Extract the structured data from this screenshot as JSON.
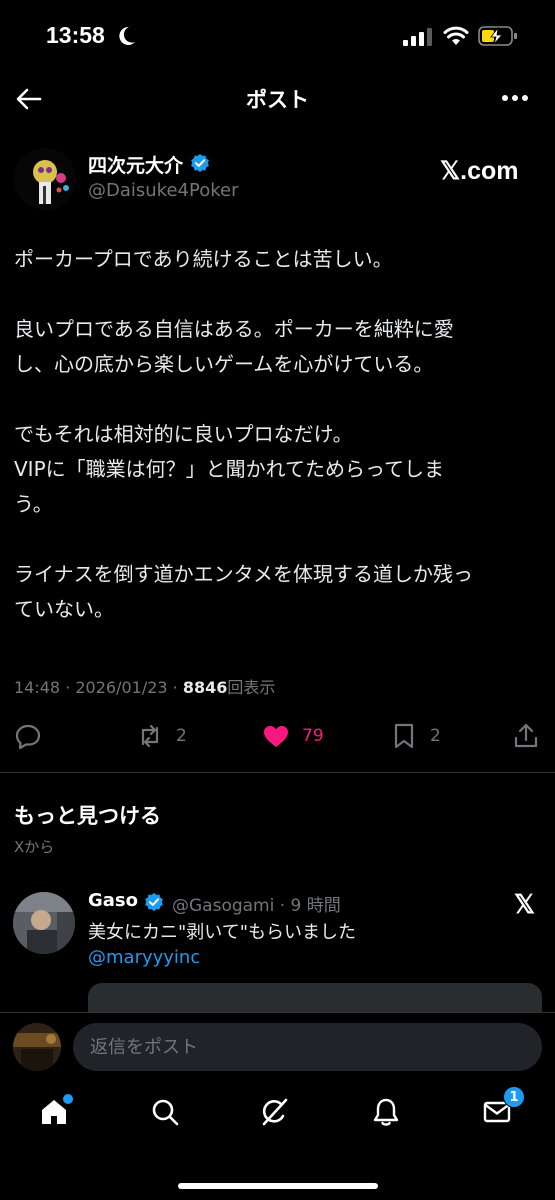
{
  "status_bar": {
    "time": "13:58",
    "icons": [
      "moon-icon",
      "signal-icon",
      "wifi-icon",
      "battery-charging-icon"
    ]
  },
  "header": {
    "title": "ポスト",
    "back_icon": "arrow-left-icon",
    "more_icon": "more-horizontal-icon"
  },
  "post": {
    "author_name": "四次元大介",
    "author_handle": "@Daisuke4Poker",
    "source": "𝕏.com",
    "paragraphs": [
      "ポーカープロであり続けることは苦しい。",
      "良いプロである自信はある。ポーカーを純粋に愛し、心の底から楽しいゲームを心がけている。",
      "でもそれは相対的に良いプロなだけ。\nVIPに「職業は何？」と聞かれてためらってしまう。",
      "ライナスを倒す道かエンタメを体現する道しか残っていない。"
    ],
    "paragraph_lines": [
      [
        "ポーカープロであり続けることは苦しい。"
      ],
      [
        "良いプロである自信はある。ポーカーを純粋に愛",
        "し、心の底から楽しいゲームを心がけている。"
      ],
      [
        "でもそれは相対的に良いプロなだけ。",
        "VIPに「職業は何？」と聞かれてためらってしま",
        "う。"
      ],
      [
        "ライナスを倒す道かエンタメを体現する道しか残っ",
        "ていない。"
      ]
    ],
    "time": "14:48",
    "date": "2026/01/23",
    "views": "8846",
    "views_label": "回表示",
    "separator": " · "
  },
  "actions": {
    "replies": "",
    "reposts": "2",
    "likes": "79",
    "bookmarks": "2",
    "like_color": "#f91880"
  },
  "discover": {
    "title": "もっと見つける",
    "subtitle": "Xから",
    "rec": {
      "name": "Gaso",
      "handle": "@Gasogami · 9 時間",
      "source": "𝕏",
      "text": "美女にカニ\"剥いて\"もらいました",
      "mention": "@maryyyinc"
    }
  },
  "reply_bar": {
    "placeholder": "返信をポスト"
  },
  "tabbar": {
    "items": [
      "home-icon",
      "search-icon",
      "grok-icon",
      "bell-icon",
      "mail-icon"
    ],
    "messages_badge": "1"
  },
  "colors": {
    "background": "#000000",
    "accent": "#1d9bf0",
    "secondary_text": "#71767b",
    "like": "#f91880"
  }
}
